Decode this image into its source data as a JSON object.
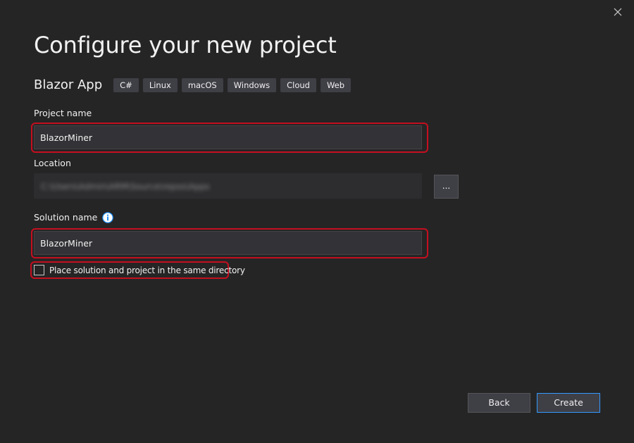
{
  "dialog": {
    "title": "Configure your new project",
    "close_icon": "close-icon"
  },
  "template": {
    "name": "Blazor App",
    "tags": [
      "C#",
      "Linux",
      "macOS",
      "Windows",
      "Cloud",
      "Web"
    ]
  },
  "project": {
    "label": "Project name",
    "value": "BlazorMiner"
  },
  "location": {
    "label": "Location",
    "value": "C:\\Users\\Admin\\ARM\\Source\\repos\\Apps",
    "browse_label": "..."
  },
  "solution": {
    "label": "Solution name",
    "value": "BlazorMiner",
    "info_icon": "info-icon"
  },
  "same_directory": {
    "label": "Place solution and project in the same directory",
    "checked": false
  },
  "buttons": {
    "back": "Back",
    "create": "Create"
  },
  "colors": {
    "background": "#252526",
    "highlight": "#c50f1f",
    "focus_border": "#3399ff",
    "info": "#1e90ff"
  }
}
